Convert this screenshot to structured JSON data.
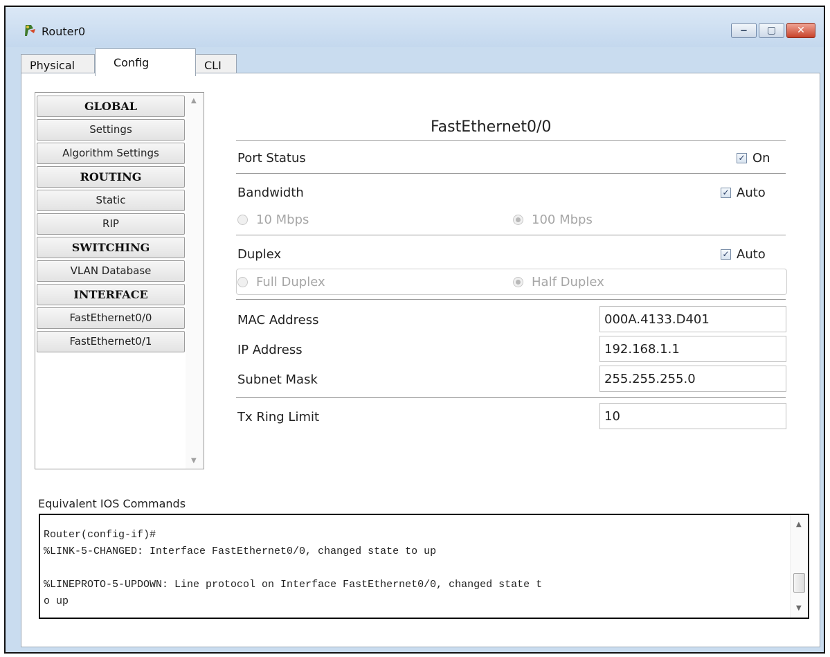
{
  "window": {
    "title": "Router0",
    "controls": {
      "minimize": "‒",
      "maximize": "▢",
      "close": "✕"
    }
  },
  "tabs": [
    {
      "label": "Physical",
      "active": false
    },
    {
      "label": "Config",
      "active": true
    },
    {
      "label": "CLI",
      "active": false
    }
  ],
  "nav": {
    "items": [
      {
        "label": "GLOBAL",
        "header": true
      },
      {
        "label": "Settings",
        "header": false
      },
      {
        "label": "Algorithm Settings",
        "header": false
      },
      {
        "label": "ROUTING",
        "header": true
      },
      {
        "label": "Static",
        "header": false
      },
      {
        "label": "RIP",
        "header": false
      },
      {
        "label": "SWITCHING",
        "header": true
      },
      {
        "label": "VLAN Database",
        "header": false
      },
      {
        "label": "INTERFACE",
        "header": true
      },
      {
        "label": "FastEthernet0/0",
        "header": false
      },
      {
        "label": "FastEthernet0/1",
        "header": false
      }
    ]
  },
  "interface": {
    "title": "FastEthernet0/0",
    "port_status": {
      "label": "Port Status",
      "checkbox_label": "On",
      "checked": true
    },
    "bandwidth": {
      "label": "Bandwidth",
      "checkbox_label": "Auto",
      "checked": true,
      "options": [
        {
          "label": "10 Mbps",
          "selected": false
        },
        {
          "label": "100 Mbps",
          "selected": true
        }
      ]
    },
    "duplex": {
      "label": "Duplex",
      "checkbox_label": "Auto",
      "checked": true,
      "options": [
        {
          "label": "Full Duplex",
          "selected": false
        },
        {
          "label": "Half Duplex",
          "selected": true
        }
      ]
    },
    "mac_address": {
      "label": "MAC Address",
      "value": "000A.4133.D401"
    },
    "ip_address": {
      "label": "IP Address",
      "value": "192.168.1.1"
    },
    "subnet_mask": {
      "label": "Subnet Mask",
      "value": "255.255.255.0"
    },
    "tx_ring_limit": {
      "label": "Tx Ring Limit",
      "value": "10"
    }
  },
  "ios": {
    "label": "Equivalent IOS Commands",
    "lines": [
      "Router(config-if)#",
      "%LINK-5-CHANGED: Interface FastEthernet0/0, changed state to up",
      "",
      "%LINEPROTO-5-UPDOWN: Line protocol on Interface FastEthernet0/0, changed state t",
      "o up"
    ]
  },
  "icons": {
    "app": "router-icon",
    "checkmark": "✓",
    "scroll_up": "▲",
    "scroll_down": "▼"
  },
  "colors": {
    "window_frame": "#c9dcef",
    "close_button": "#c8432b"
  }
}
